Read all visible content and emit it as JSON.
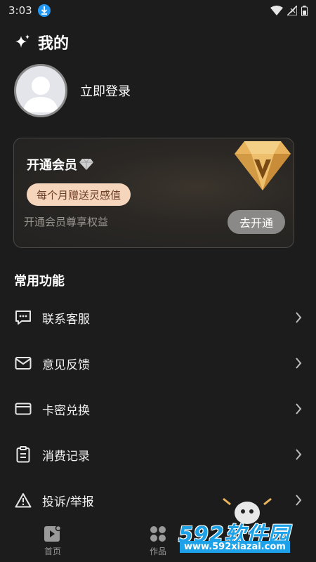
{
  "status_bar": {
    "time": "3:03"
  },
  "header": {
    "title": "我的"
  },
  "profile": {
    "login_label": "立即登录"
  },
  "vip_card": {
    "title": "开通会员",
    "badge_text": "每个月赠送灵感值",
    "description": "开通会员尊享权益",
    "action_label": "去开通"
  },
  "section": {
    "title": "常用功能"
  },
  "menu": [
    {
      "label": "联系客服",
      "icon": "chat-icon"
    },
    {
      "label": "意见反馈",
      "icon": "mail-icon"
    },
    {
      "label": "卡密兑换",
      "icon": "card-icon"
    },
    {
      "label": "消费记录",
      "icon": "clipboard-icon"
    },
    {
      "label": "投诉/举报",
      "icon": "warning-icon"
    }
  ],
  "bottom_nav": [
    {
      "label": "首页",
      "icon": "video-icon"
    },
    {
      "label": "作品",
      "icon": "grid-icon"
    }
  ],
  "watermark": {
    "brand": "592软件园",
    "url": "www.592xiazai.com"
  },
  "colors": {
    "background": "#1c1c1c",
    "vip_badge_bg": "#f6d5bd",
    "vip_badge_text": "#6b3f26",
    "gem_gold": "#e8b35c",
    "watermark_blue": "#1da1e8"
  }
}
